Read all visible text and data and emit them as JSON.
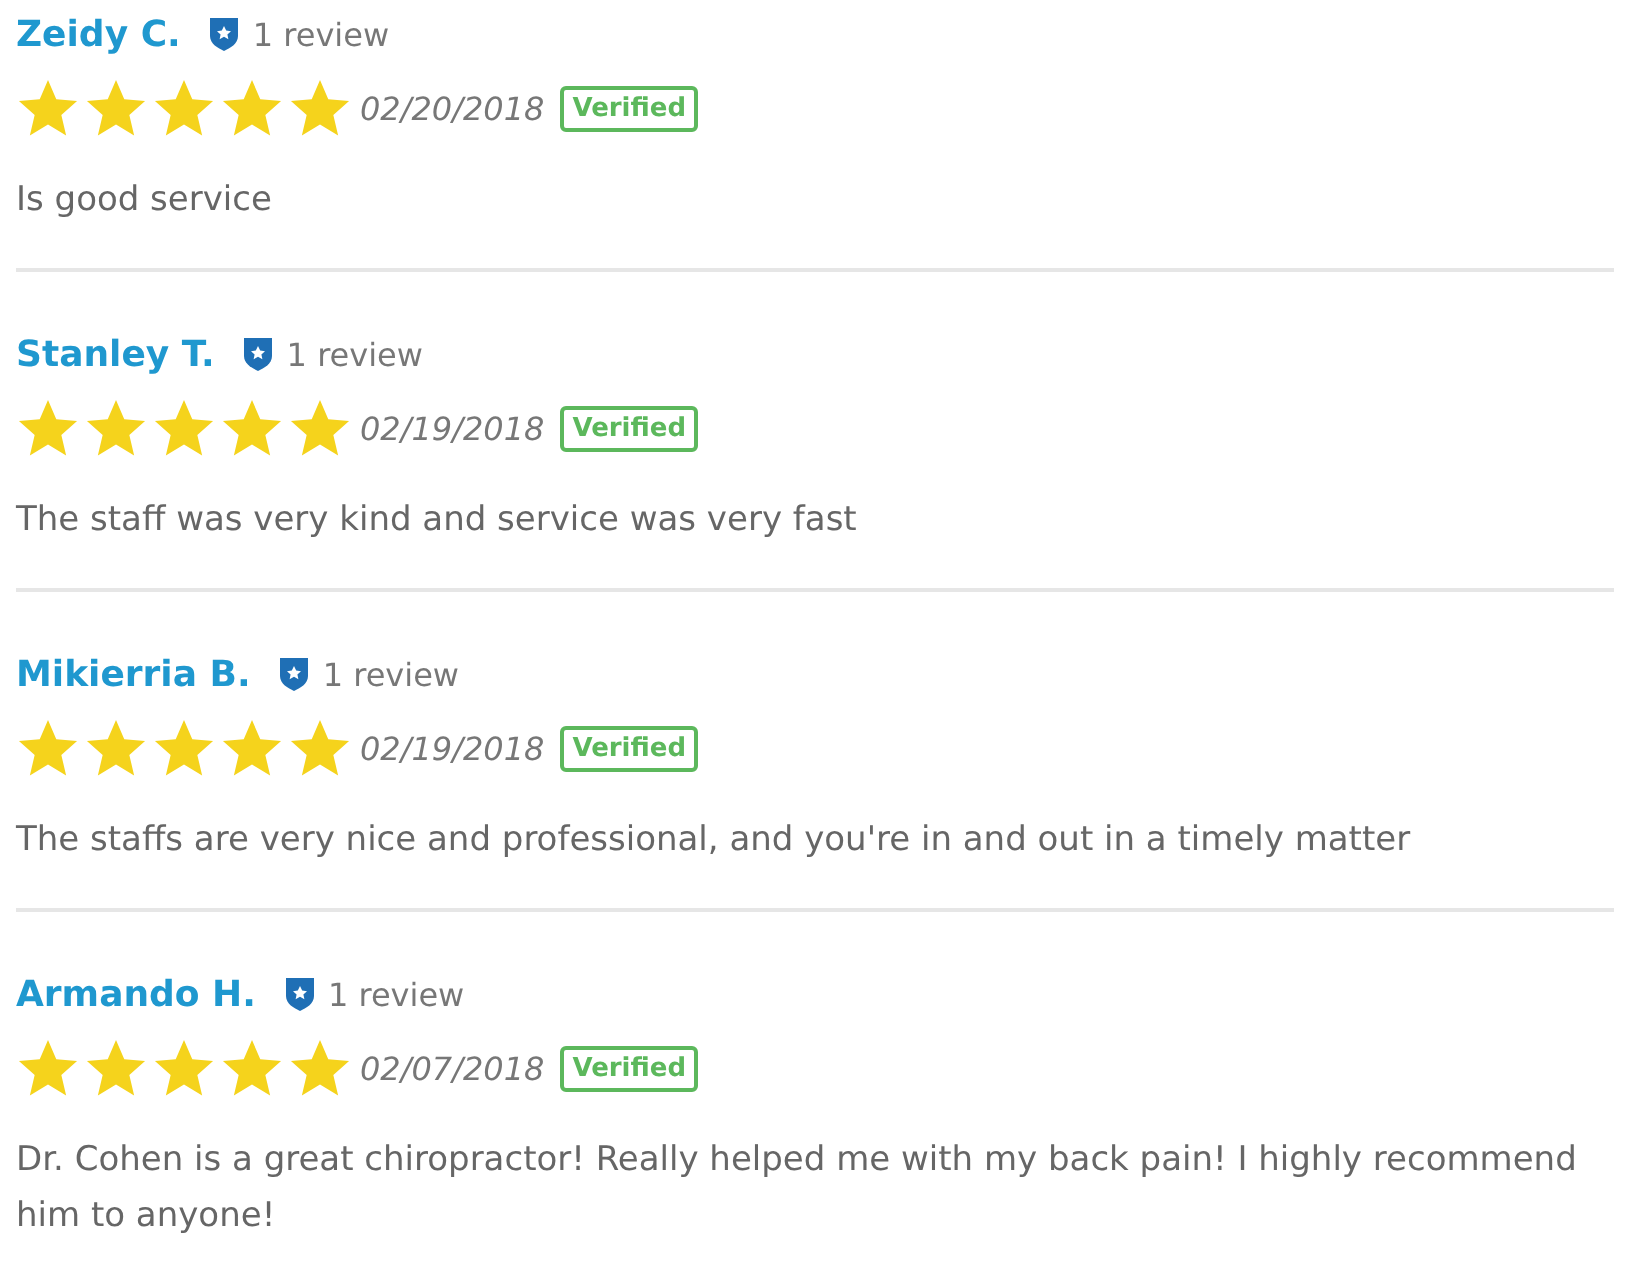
{
  "reviews": [
    {
      "name": "Zeidy C.",
      "review_count": "1 review",
      "stars": 5,
      "date": "02/20/2018",
      "badge": "Verified",
      "text": "Is good service"
    },
    {
      "name": "Stanley T.",
      "review_count": "1 review",
      "stars": 5,
      "date": "02/19/2018",
      "badge": "Verified",
      "text": "The staff was very kind and service was very fast"
    },
    {
      "name": "Mikierria B.",
      "review_count": "1 review",
      "stars": 5,
      "date": "02/19/2018",
      "badge": "Verified",
      "text": "The staffs are very nice and professional, and you're in and out in a timely matter"
    },
    {
      "name": "Armando H.",
      "review_count": "1 review",
      "stars": 5,
      "date": "02/07/2018",
      "badge": "Verified",
      "text": "Dr. Cohen is a great chiropractor! Really helped me with my back pain! I highly recommend him to anyone!"
    }
  ]
}
